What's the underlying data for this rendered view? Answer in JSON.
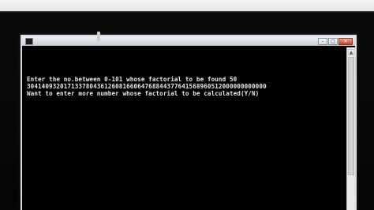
{
  "window": {
    "title": "",
    "controls": {
      "minimize_glyph": "–",
      "maximize_glyph": "□",
      "close_glyph": "✕"
    }
  },
  "console": {
    "lines": [
      "Enter the no.between 0-101 whose factorial to be found 50",
      "30414093201713378043612608166064768844377641568960512000000000000",
      "Want to enter more number whose factorial to be calculated(Y/N)"
    ]
  },
  "scrollbar": {
    "up_glyph": "▲"
  },
  "icons": {
    "app_icon": "console-app-icon",
    "mouse_cursor": "text-cursor-icon"
  }
}
